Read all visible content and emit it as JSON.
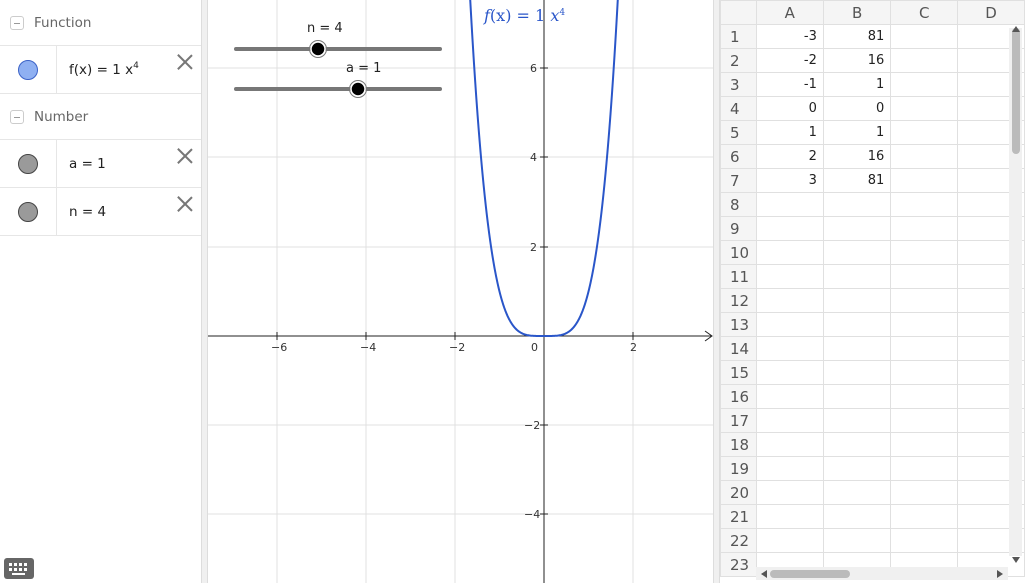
{
  "algebra": {
    "categories": [
      {
        "name": "Function",
        "items": [
          {
            "name_text": "f(x)",
            "eq": "=",
            "coef": "1 x",
            "exp": "4",
            "color": "#8fb0f2"
          }
        ]
      },
      {
        "name": "Number",
        "items": [
          {
            "text": "a = 1"
          },
          {
            "text": "n = 4"
          }
        ]
      }
    ]
  },
  "graphics": {
    "sliders": [
      {
        "label": "n = 4",
        "value": 4
      },
      {
        "label": "a = 1",
        "value": 1
      }
    ],
    "function_label": {
      "f": "f",
      "x": "(x)",
      "eq": "=",
      "rhs": "1",
      "var": "x",
      "exp": "4"
    },
    "x_ticks": [
      "−6",
      "−4",
      "−2",
      "0",
      "2"
    ],
    "y_ticks": [
      "6",
      "4",
      "2",
      "−2",
      "−4"
    ],
    "curve_color": "#2a56c9"
  },
  "spreadsheet": {
    "columns": [
      "A",
      "B",
      "C",
      "D"
    ],
    "rows": [
      {
        "n": "1",
        "A": "-3",
        "B": "81"
      },
      {
        "n": "2",
        "A": "-2",
        "B": "16"
      },
      {
        "n": "3",
        "A": "-1",
        "B": "1"
      },
      {
        "n": "4",
        "A": "0",
        "B": "0"
      },
      {
        "n": "5",
        "A": "1",
        "B": "1"
      },
      {
        "n": "6",
        "A": "2",
        "B": "16"
      },
      {
        "n": "7",
        "A": "3",
        "B": "81"
      },
      {
        "n": "8"
      },
      {
        "n": "9"
      },
      {
        "n": "10"
      },
      {
        "n": "11"
      },
      {
        "n": "12"
      },
      {
        "n": "13"
      },
      {
        "n": "14"
      },
      {
        "n": "15"
      },
      {
        "n": "16"
      },
      {
        "n": "17"
      },
      {
        "n": "18"
      },
      {
        "n": "19"
      },
      {
        "n": "20"
      },
      {
        "n": "21"
      },
      {
        "n": "22"
      },
      {
        "n": "23"
      }
    ]
  },
  "icons": {
    "keyboard": "keyboard-icon",
    "close": "close-icon",
    "collapse": "collapse-icon"
  }
}
